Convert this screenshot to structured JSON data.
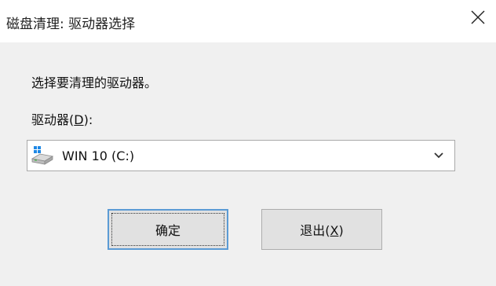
{
  "window": {
    "title": "磁盘清理: 驱动器选择",
    "close_icon": "close-icon"
  },
  "main": {
    "prompt": "选择要清理的驱动器。",
    "drive_label_prefix": "驱动器(",
    "drive_label_key": "D",
    "drive_label_suffix": "):",
    "drive_select": {
      "selected": "WIN 10 (C:)",
      "icon": "windows-drive-icon"
    }
  },
  "buttons": {
    "ok_label": "确定",
    "exit_label_prefix": "退出(",
    "exit_label_key": "X",
    "exit_label_suffix": ")"
  }
}
